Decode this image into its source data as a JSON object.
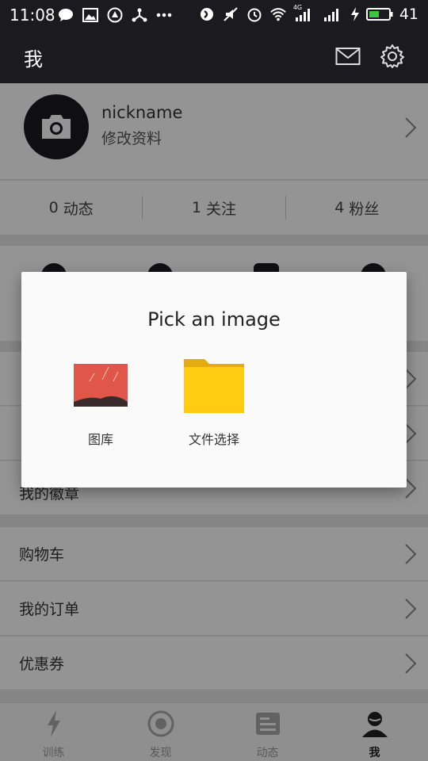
{
  "status_bar": {
    "time": "11:08",
    "network": "4G",
    "battery": "41",
    "icons": [
      "message-icon",
      "gallery-icon",
      "app-icon",
      "share-icon",
      "more-icon",
      "do-not-disturb-icon",
      "mute-icon",
      "alarm-icon",
      "wifi-icon",
      "signal-icon",
      "charging-icon",
      "battery-icon"
    ]
  },
  "header": {
    "title": "我",
    "icons": [
      "mail-icon",
      "settings-icon"
    ]
  },
  "profile": {
    "nickname": "nickname",
    "edit_label": "修改资料"
  },
  "stats": [
    {
      "count": "0",
      "label": "动态"
    },
    {
      "count": "1",
      "label": "关注"
    },
    {
      "count": "4",
      "label": "粉丝"
    }
  ],
  "list": {
    "badge_partial": "我的徽章",
    "items": [
      "购物车",
      "我的订单",
      "优惠券"
    ]
  },
  "bottom_nav": [
    {
      "label": "训练",
      "icon": "lightning-icon"
    },
    {
      "label": "发现",
      "icon": "target-icon"
    },
    {
      "label": "动态",
      "icon": "feed-icon"
    },
    {
      "label": "我",
      "icon": "person-icon",
      "active": true
    }
  ],
  "dialog": {
    "title": "Pick an image",
    "options": [
      {
        "label": "图库",
        "icon": "gallery-icon"
      },
      {
        "label": "文件选择",
        "icon": "folder-icon"
      }
    ]
  },
  "colors": {
    "dark_bar": "#1a1a1f",
    "overlay": "rgba(0,0,0,0.42)",
    "folder": "#ffcc11",
    "gallery_red": "#e0574a"
  }
}
